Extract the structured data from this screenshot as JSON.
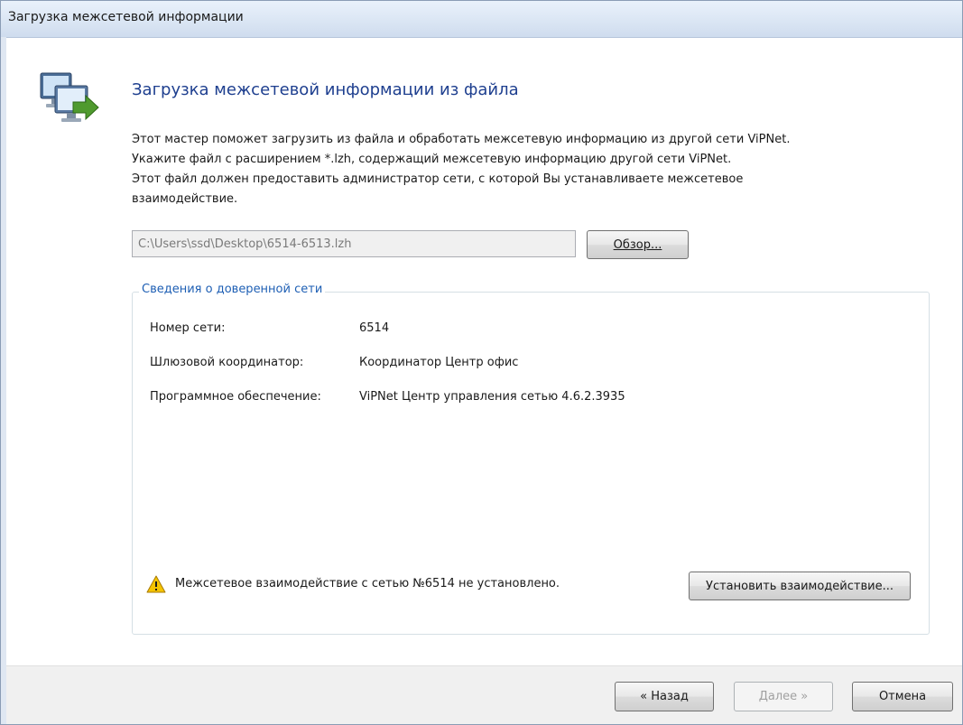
{
  "window": {
    "title": "Загрузка межсетевой информации"
  },
  "header": {
    "title": "Загрузка межсетевой информации из файла",
    "icon": "network-computers-import-icon"
  },
  "description": {
    "line1": "Этот мастер поможет загрузить из файла и обработать межсетевую информацию из другой сети ViPNet.",
    "line2": "Укажите файл с расширением *.lzh, содержащий межсетевую информацию другой сети ViPNet.",
    "line3": "Этот файл должен предоставить администратор сети, с которой Вы устанавливаете межсетевое",
    "line4": "взаимодействие."
  },
  "file": {
    "path": "C:\\Users\\ssd\\Desktop\\6514-6513.lzh",
    "browse_label": "Обзор..."
  },
  "trusted_network": {
    "legend": "Сведения о доверенной сети",
    "network_number_label": "Номер сети:",
    "network_number_value": "6514",
    "gateway_label": "Шлюзовой координатор:",
    "gateway_value": "Координатор Центр офис",
    "software_label": "Программное обеспечение:",
    "software_value": "ViPNet Центр управления сетью 4.6.2.3935"
  },
  "status": {
    "icon": "warning-icon",
    "text": "Межсетевое взаимодействие с сетью №6514 не установлено.",
    "establish_label": "Установить взаимодействие..."
  },
  "footer": {
    "back_label": "« Назад",
    "next_label": "Далее »",
    "cancel_label": "Отмена"
  },
  "colors": {
    "title_blue": "#1e3f8f",
    "legend_blue": "#1e5fb4",
    "warning_yellow": "#f5c400"
  }
}
